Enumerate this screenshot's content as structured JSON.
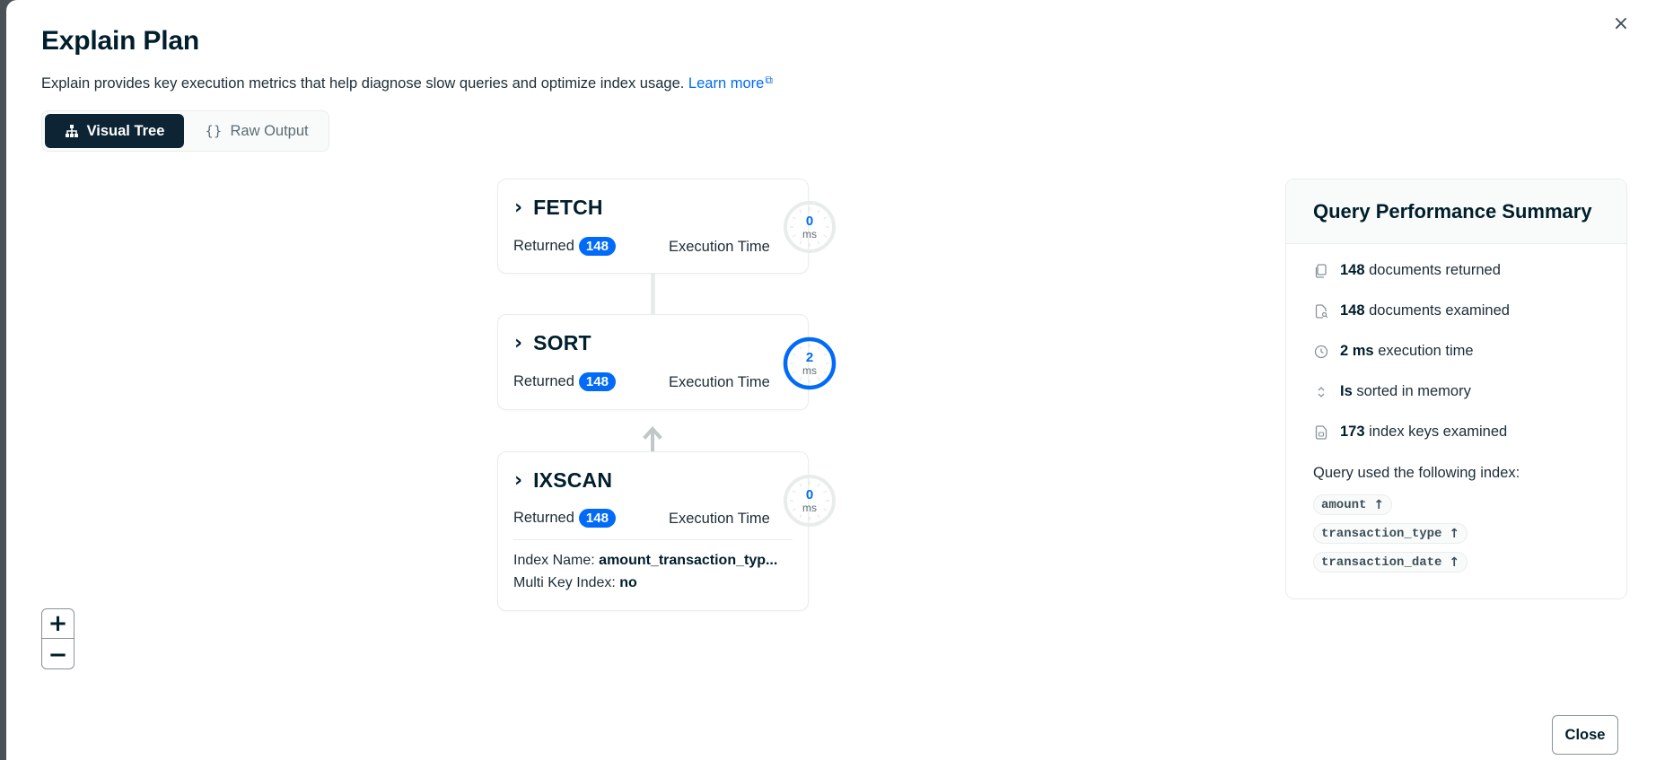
{
  "modal": {
    "title": "Explain Plan",
    "description": "Explain provides key execution metrics that help diagnose slow queries and optimize index usage.",
    "learn_more": "Learn more",
    "close_label": "Close",
    "close_icon": "×"
  },
  "view_toggle": {
    "options": [
      {
        "label": "Visual Tree",
        "icon": "tree-icon",
        "selected": true
      },
      {
        "label": "Raw Output",
        "icon": "braces-icon",
        "selected": false
      }
    ]
  },
  "tree": {
    "nodes": [
      {
        "name": "FETCH",
        "returned_label": "Returned",
        "returned": "148",
        "exec_label": "Execution Time",
        "exec_value": "0",
        "exec_unit": "ms",
        "exec_fraction": 0
      },
      {
        "name": "SORT",
        "returned_label": "Returned",
        "returned": "148",
        "exec_label": "Execution Time",
        "exec_value": "2",
        "exec_unit": "ms",
        "exec_fraction": 1
      },
      {
        "name": "IXSCAN",
        "returned_label": "Returned",
        "returned": "148",
        "exec_label": "Execution Time",
        "exec_value": "0",
        "exec_unit": "ms",
        "exec_fraction": 0,
        "index_name_label": "Index Name:",
        "index_name": "amount_transaction_typ...",
        "multi_key_label": "Multi Key Index:",
        "multi_key": "no"
      }
    ]
  },
  "zoom": {
    "in": "+",
    "out": "−"
  },
  "summary": {
    "title": "Query Performance Summary",
    "stats": [
      {
        "icon": "documents-icon",
        "value": "148",
        "text": "documents returned"
      },
      {
        "icon": "document-search-icon",
        "value": "148",
        "text": "documents examined"
      },
      {
        "icon": "clock-icon",
        "value": "2 ms",
        "text": "execution time"
      },
      {
        "icon": "sort-icon",
        "value": "Is",
        "text": "sorted in memory"
      },
      {
        "icon": "index-icon",
        "value": "173",
        "text": "index keys examined"
      }
    ],
    "index_label": "Query used the following index:",
    "index_fields": [
      {
        "name": "amount",
        "direction": "↑"
      },
      {
        "name": "transaction_type",
        "direction": "↑"
      },
      {
        "name": "transaction_date",
        "direction": "↑"
      }
    ]
  },
  "colors": {
    "accent": "#016bf8",
    "dark": "#001e2b",
    "border": "#e8edeb"
  }
}
